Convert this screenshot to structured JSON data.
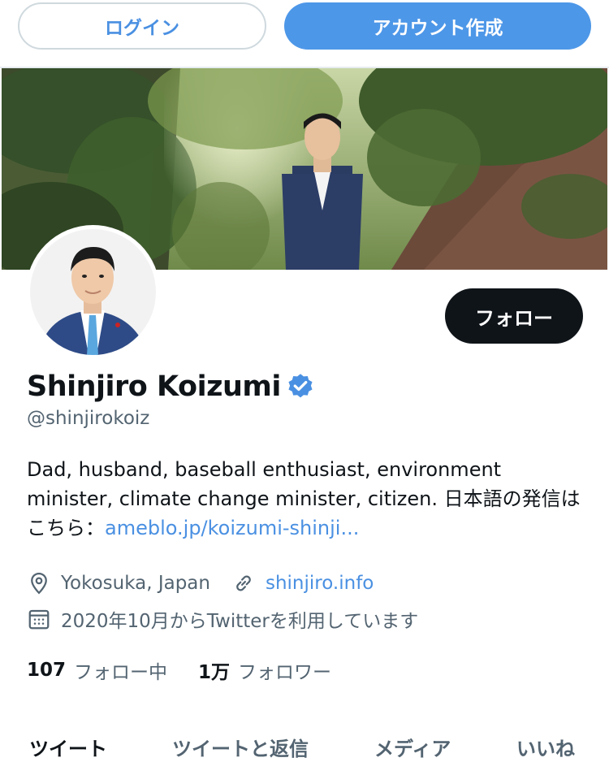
{
  "header": {
    "login_label": "ログイン",
    "signup_label": "アカウント作成"
  },
  "profile": {
    "name": "Shinjiro Koizumi",
    "handle": "@shinjirokoiz",
    "follow_label": "フォロー",
    "bio_text": "Dad, husband, baseball enthusiast, environment minister, climate change minister, citizen. 日本語の発信はこちら：",
    "bio_link": "ameblo.jp/koizumi-shinji...",
    "location": "Yokosuka, Japan",
    "website": "shinjiro.info",
    "joined": "2020年10月からTwitterを利用しています",
    "following_count": "107",
    "following_label": "フォロー中",
    "followers_count": "1万",
    "followers_label": "フォロワー"
  },
  "tabs": [
    {
      "label": "ツイート"
    },
    {
      "label": "ツイートと返信"
    },
    {
      "label": "メディア"
    },
    {
      "label": "いいね"
    }
  ],
  "colors": {
    "accent": "#4a90e2",
    "follow_button": "#0f1419",
    "verified": "#4a90e2"
  },
  "icons": {
    "verified": "verified-badge-icon",
    "location": "location-pin-icon",
    "link": "link-icon",
    "calendar": "calendar-icon"
  }
}
